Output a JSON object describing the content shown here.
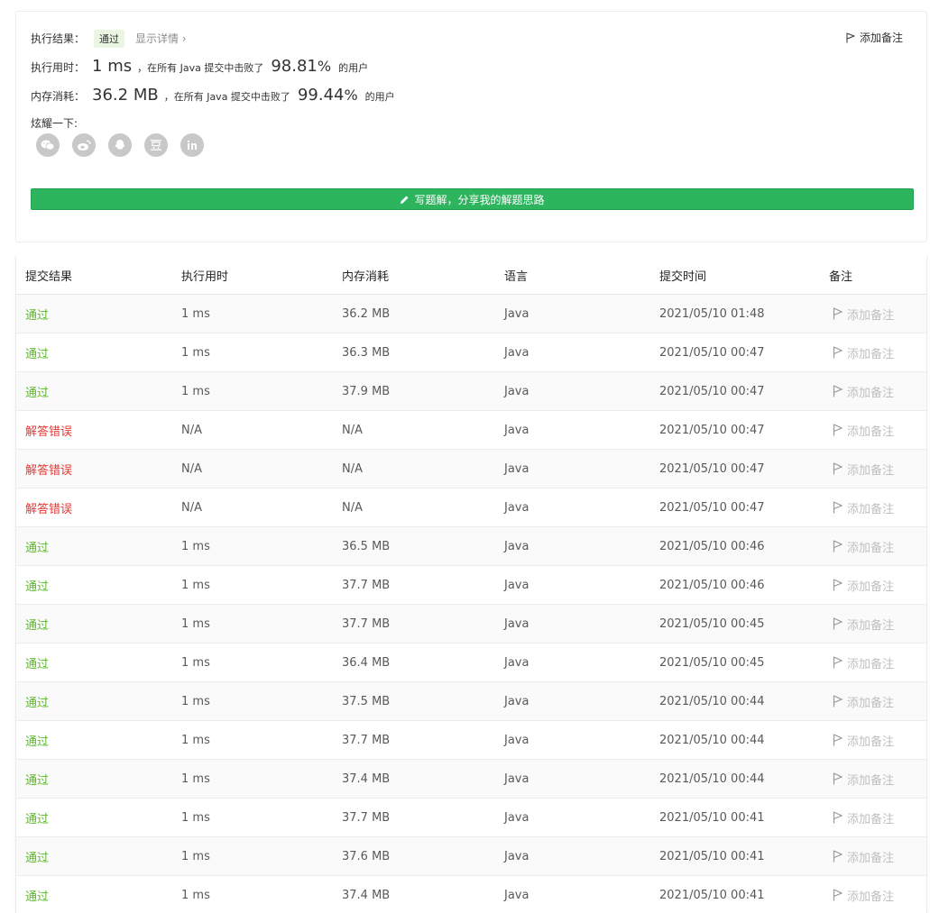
{
  "summary": {
    "result_label": "执行结果：",
    "status": "通过",
    "details_link": "显示详情 ›",
    "add_note": "添加备注",
    "runtime_label": "执行用时：",
    "runtime_value": "1 ms",
    "runtime_mid": "，在所有 Java 提交中击败了",
    "runtime_pct": "98.81",
    "runtime_pct_sign": "%",
    "runtime_tail": "的用户",
    "memory_label": "内存消耗：",
    "memory_value": "36.2 MB",
    "memory_mid": "，在所有 Java 提交中击败了",
    "memory_pct": "99.44",
    "memory_pct_sign": "%",
    "memory_tail": "的用户",
    "share_label": "炫耀一下:",
    "share_icons": [
      "wechat-icon",
      "weibo-icon",
      "qq-icon",
      "douban-icon",
      "linkedin-icon"
    ],
    "write_solution": "写题解，分享我的解题思路"
  },
  "table": {
    "headers": [
      "提交结果",
      "执行用时",
      "内存消耗",
      "语言",
      "提交时间",
      "备注"
    ],
    "note_label": "添加备注",
    "rows": [
      {
        "result": "通过",
        "status": "ok",
        "time": "1 ms",
        "memory": "36.2 MB",
        "lang": "Java",
        "submitted": "2021/05/10 01:48"
      },
      {
        "result": "通过",
        "status": "ok",
        "time": "1 ms",
        "memory": "36.3 MB",
        "lang": "Java",
        "submitted": "2021/05/10 00:47"
      },
      {
        "result": "通过",
        "status": "ok",
        "time": "1 ms",
        "memory": "37.9 MB",
        "lang": "Java",
        "submitted": "2021/05/10 00:47"
      },
      {
        "result": "解答错误",
        "status": "err",
        "time": "N/A",
        "memory": "N/A",
        "lang": "Java",
        "submitted": "2021/05/10 00:47"
      },
      {
        "result": "解答错误",
        "status": "err",
        "time": "N/A",
        "memory": "N/A",
        "lang": "Java",
        "submitted": "2021/05/10 00:47"
      },
      {
        "result": "解答错误",
        "status": "err",
        "time": "N/A",
        "memory": "N/A",
        "lang": "Java",
        "submitted": "2021/05/10 00:47"
      },
      {
        "result": "通过",
        "status": "ok",
        "time": "1 ms",
        "memory": "36.5 MB",
        "lang": "Java",
        "submitted": "2021/05/10 00:46"
      },
      {
        "result": "通过",
        "status": "ok",
        "time": "1 ms",
        "memory": "37.7 MB",
        "lang": "Java",
        "submitted": "2021/05/10 00:46"
      },
      {
        "result": "通过",
        "status": "ok",
        "time": "1 ms",
        "memory": "37.7 MB",
        "lang": "Java",
        "submitted": "2021/05/10 00:45"
      },
      {
        "result": "通过",
        "status": "ok",
        "time": "1 ms",
        "memory": "36.4 MB",
        "lang": "Java",
        "submitted": "2021/05/10 00:45"
      },
      {
        "result": "通过",
        "status": "ok",
        "time": "1 ms",
        "memory": "37.5 MB",
        "lang": "Java",
        "submitted": "2021/05/10 00:44"
      },
      {
        "result": "通过",
        "status": "ok",
        "time": "1 ms",
        "memory": "37.7 MB",
        "lang": "Java",
        "submitted": "2021/05/10 00:44"
      },
      {
        "result": "通过",
        "status": "ok",
        "time": "1 ms",
        "memory": "37.4 MB",
        "lang": "Java",
        "submitted": "2021/05/10 00:44"
      },
      {
        "result": "通过",
        "status": "ok",
        "time": "1 ms",
        "memory": "37.7 MB",
        "lang": "Java",
        "submitted": "2021/05/10 00:41"
      },
      {
        "result": "通过",
        "status": "ok",
        "time": "1 ms",
        "memory": "37.6 MB",
        "lang": "Java",
        "submitted": "2021/05/10 00:41"
      },
      {
        "result": "通过",
        "status": "ok",
        "time": "1 ms",
        "memory": "37.4 MB",
        "lang": "Java",
        "submitted": "2021/05/10 00:41"
      }
    ]
  },
  "colors": {
    "accepted": "#5cb82a",
    "wrong_answer": "#e53935",
    "button_green": "#2db55d",
    "muted": "#bfbfbf"
  }
}
